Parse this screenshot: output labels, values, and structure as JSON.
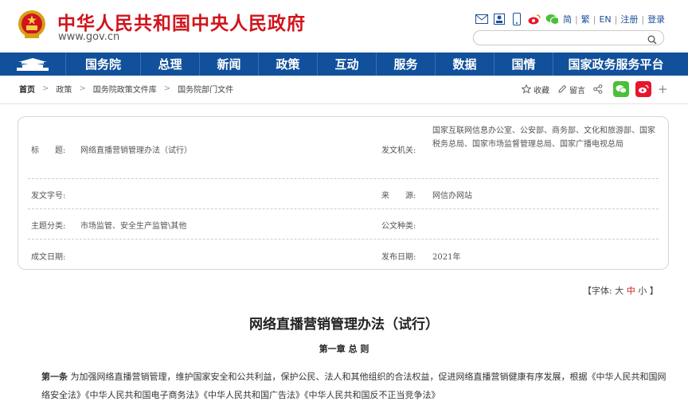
{
  "header": {
    "site_title": "中华人民共和国中央人民政府",
    "site_url": "www.gov.cn",
    "lang_links": [
      "简",
      "繁",
      "EN",
      "注册",
      "登录"
    ],
    "search_placeholder": "",
    "tool_icons": [
      "mail-icon",
      "user-icon",
      "mobile-icon",
      "weibo-icon",
      "wechat-icon"
    ]
  },
  "nav": {
    "items": [
      "国务院",
      "总理",
      "新闻",
      "政策",
      "互动",
      "服务",
      "数据",
      "国情",
      "国家政务服务平台"
    ]
  },
  "breadcrumb": {
    "items": [
      "首页",
      "政策",
      "国务院政策文件库",
      "国务院部门文件"
    ]
  },
  "share": {
    "favorite": "收藏",
    "comment": "留言",
    "plus": "+"
  },
  "meta": {
    "title_label": "标　　题:",
    "title_value": "网络直播营销管理办法（试行）",
    "issuer_label": "发文机关:",
    "issuer_value": "国家互联网信息办公室、公安部、商务部、文化和旅游部、国家税务总局、国家市场监督管理总局、国家广播电视总局",
    "docno_label": "发文字号:",
    "docno_value": "",
    "source_label": "来　　源:",
    "source_value": "网信办网站",
    "topic_label": "主题分类:",
    "topic_value": "市场监管、安全生产监管\\其他",
    "type_label": "公文种类:",
    "type_value": "",
    "created_label": "成文日期:",
    "created_value": "",
    "published_label": "发布日期:",
    "published_value": "2021年"
  },
  "fontsize": {
    "prefix": "【字体:",
    "large": "大",
    "medium": "中",
    "small": "小",
    "suffix": "】"
  },
  "doc": {
    "title": "网络直播营销管理办法（试行）",
    "chapter": "第一章 总 则",
    "article_label": "第一条",
    "article_text": " 为加强网络直播营销管理，维护国家安全和公共利益，保护公民、法人和其他组织的合法权益，促进网络直播营销健康有序发展，根据《中华人民共和国网络安全法》《中华人民共和国电子商务法》《中华人民共和国广告法》《中华人民共和国反不正当竞争法》"
  },
  "colors": {
    "brand_red": "#d0141c",
    "nav_blue": "#11509b",
    "wechat_green": "#4cbf3a",
    "weibo_red": "#e6162d"
  }
}
